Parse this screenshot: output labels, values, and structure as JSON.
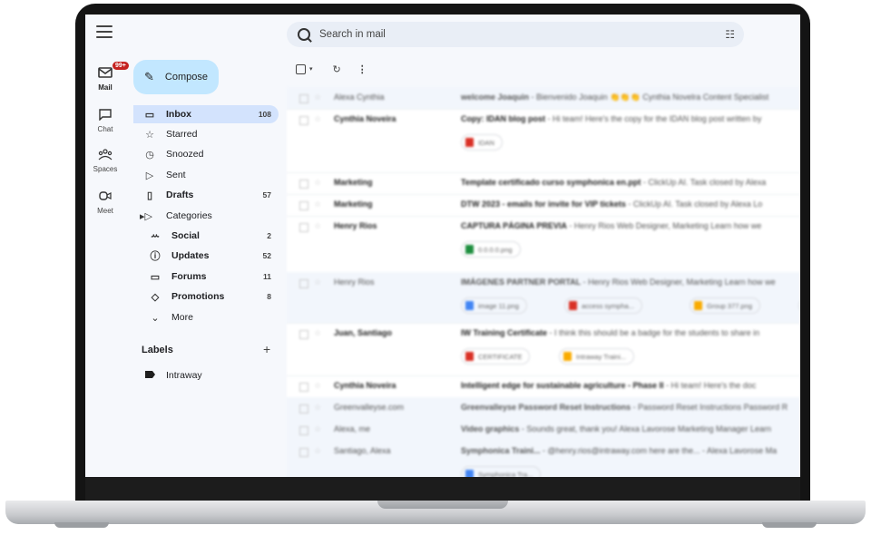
{
  "rail": {
    "mail_badge": "99+",
    "items": [
      {
        "label": "Mail",
        "icon": "mail-icon"
      },
      {
        "label": "Chat",
        "icon": "chat-icon"
      },
      {
        "label": "Spaces",
        "icon": "spaces-icon"
      },
      {
        "label": "Meet",
        "icon": "meet-icon"
      }
    ]
  },
  "compose_label": "Compose",
  "search": {
    "placeholder": "Search in mail"
  },
  "nav": [
    {
      "label": "Inbox",
      "count": "108",
      "icon": "inbox-icon",
      "glyph": "▭"
    },
    {
      "label": "Starred",
      "count": "",
      "icon": "star-icon",
      "glyph": "☆"
    },
    {
      "label": "Snoozed",
      "count": "",
      "icon": "clock-icon",
      "glyph": "◷"
    },
    {
      "label": "Sent",
      "count": "",
      "icon": "send-icon",
      "glyph": "▷"
    },
    {
      "label": "Drafts",
      "count": "57",
      "icon": "draft-icon",
      "glyph": "▯"
    },
    {
      "label": "Categories",
      "count": "",
      "icon": "label-outline-icon",
      "glyph": "▸▷"
    },
    {
      "label": "Social",
      "count": "2",
      "icon": "people-icon",
      "glyph": "ꕀ"
    },
    {
      "label": "Updates",
      "count": "52",
      "icon": "info-icon",
      "glyph": "ⓘ"
    },
    {
      "label": "Forums",
      "count": "11",
      "icon": "forum-icon",
      "glyph": "▭"
    },
    {
      "label": "Promotions",
      "count": "8",
      "icon": "tag-icon",
      "glyph": "◇"
    },
    {
      "label": "More",
      "count": "",
      "icon": "chevron-down-icon",
      "glyph": "⌄"
    }
  ],
  "labels": {
    "heading": "Labels",
    "items": [
      {
        "label": "Intraway",
        "color": "#1f1f1f"
      }
    ]
  },
  "emails": [
    {
      "sender": "Alexa Cynthia",
      "subject": "welcome Joaquin",
      "snippet": " - Bienvenido Joaquin 👏👏👏 Cynthia Novelra Content Specialist",
      "read": true
    },
    {
      "sender": "Cynthia Noveira",
      "subject": "Copy: IDAN blog post",
      "snippet": " - Hi team! Here's the copy for the IDAN blog post written by",
      "read": false,
      "attachments": [
        "IDAN"
      ]
    },
    {
      "sender": "Marketing",
      "subject": "Template certificado curso symphonica en.ppt",
      "snippet": " - ClickUp AI. Task closed by Alexa",
      "read": false
    },
    {
      "sender": "Marketing",
      "subject": "DTW 2023 - emails for invite for VIP tickets",
      "snippet": " - ClickUp AI. Task closed by Alexa Lo",
      "read": false
    },
    {
      "sender": "Henry Rios",
      "subject": "CAPTURA PÁGINA PREVIA",
      "snippet": " - Henry Rios Web Designer, Marketing Learn how we",
      "read": false,
      "attachments": [
        "0.0.0.0.png"
      ]
    },
    {
      "sender": "Henry Rios",
      "subject": "IMÁGENES PARTNER PORTAL",
      "snippet": " - Henry Rios Web Designer, Marketing Learn how we",
      "read": true,
      "attachments": [
        "image 11.png",
        "access sympha...",
        "Group 377.png",
        "+4"
      ]
    },
    {
      "sender": "Juan, Santiago",
      "subject": "IW Training Certificate",
      "snippet": " - I think this should be a badge for the students to share in",
      "read": false,
      "attachments": [
        "CERTIFICATE",
        "Intraway Traini..."
      ]
    },
    {
      "sender": "Cynthia Noveira",
      "subject": "Intelligent edge for sustainable agriculture - Phase II",
      "snippet": " - Hi team! Here's the doc",
      "read": false
    },
    {
      "sender": "Greenvalleyse.com",
      "subject": "Greenvalleyse Password Reset Instructions",
      "snippet": " - Password Reset Instructions Password R",
      "read": true
    },
    {
      "sender": "Alexa, me",
      "subject": "Video graphics",
      "snippet": " - Sounds great, thank you! Alexa Lavorose Marketing Manager Learn",
      "read": true
    },
    {
      "sender": "Santiago, Alexa",
      "subject": "Symphonica Traini...",
      "snippet": " - @henry.rios@intraway.com here are the... - Alexa Lavorose Ma",
      "read": true,
      "attachments": [
        "Symphonica Tra..."
      ]
    }
  ],
  "colors": {
    "accent": "#c2e7ff",
    "active_nav": "#d3e3fd",
    "background": "#f6f8fc",
    "badge": "#c5221f"
  }
}
